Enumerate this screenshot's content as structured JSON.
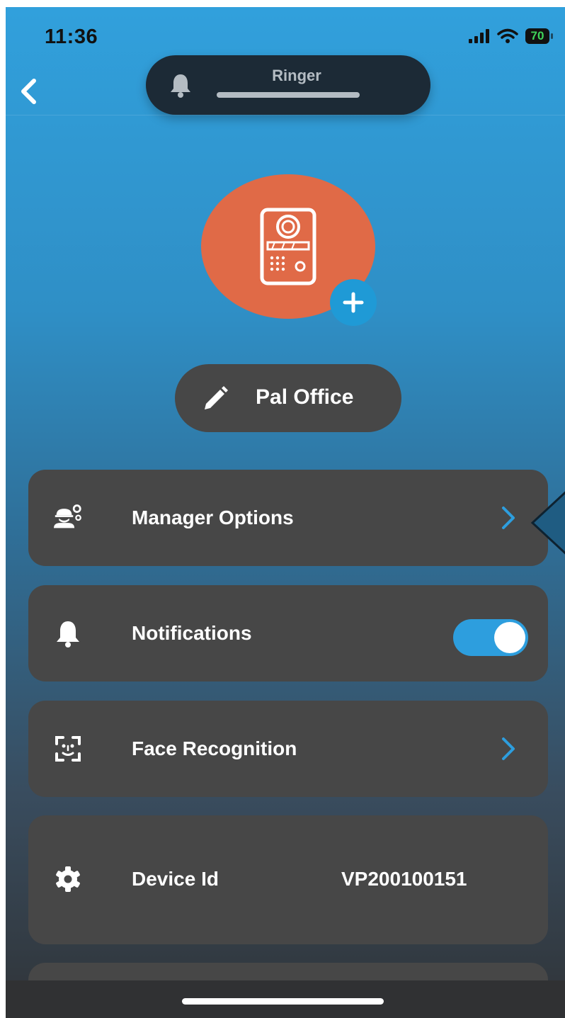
{
  "status_bar": {
    "time": "11:36",
    "battery": "70"
  },
  "ringer": {
    "label": "Ringer"
  },
  "device": {
    "name": "Pal Office"
  },
  "menu": {
    "manager_options": "Manager Options",
    "notifications": "Notifications",
    "notifications_enabled": true,
    "face_recognition": "Face Recognition",
    "device_id_label": "Device Id",
    "device_id_value": "VP200100151"
  },
  "colors": {
    "accent": "#2d9ede",
    "avatar": "#e06a47",
    "card": "#474747"
  }
}
